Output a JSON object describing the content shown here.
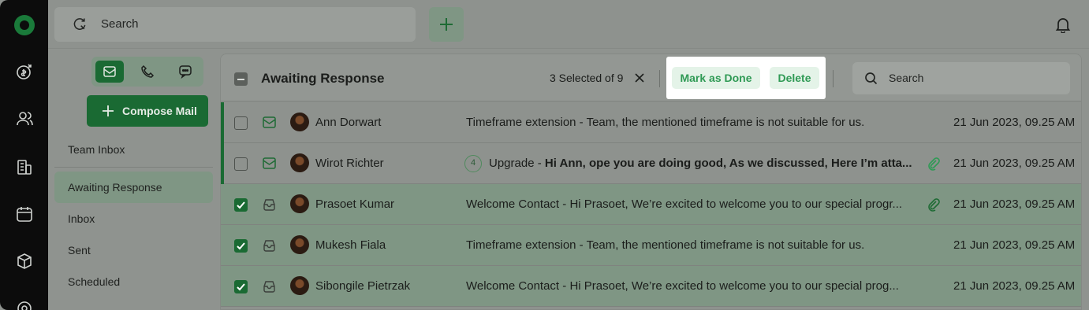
{
  "colors": {
    "brand": "#1a6a33",
    "highlight": "#e4f3e8",
    "highlight_text": "#2f9a55"
  },
  "rail": {
    "icons": [
      "logo-icon",
      "billing-icon",
      "contacts-icon",
      "company-icon",
      "calendar-icon",
      "package-icon",
      "settings-icon"
    ]
  },
  "topbar": {
    "search_placeholder": "Search"
  },
  "sidebar": {
    "compose_label": "Compose Mail",
    "items": [
      {
        "label": "Team Inbox"
      },
      {
        "label": "Awaiting Response",
        "active": true
      },
      {
        "label": "Inbox"
      },
      {
        "label": "Sent"
      },
      {
        "label": "Scheduled"
      }
    ]
  },
  "header": {
    "title": "Awaiting Response",
    "selected_text": "3 Selected of 9",
    "mark_done_label": "Mark as Done",
    "delete_label": "Delete",
    "search_placeholder": "Search"
  },
  "rows": [
    {
      "name": "Ann Dorwart",
      "subject": "Timeframe extension",
      "sep": " - ",
      "preview": "Team, the mentioned timeframe is not suitable for us.",
      "date": "21 Jun 2023, 09.25 AM",
      "checked": false,
      "count": null,
      "attachment": false,
      "preview_bold": false
    },
    {
      "name": "Wirot Richter",
      "subject": "Upgrade",
      "sep": " - ",
      "preview": "Hi Ann, ope you are doing good, As we discussed, Here I’m atta...",
      "date": "21 Jun 2023, 09.25 AM",
      "checked": false,
      "count": "4",
      "attachment": true,
      "preview_bold": true
    },
    {
      "name": "Prasoet Kumar",
      "subject": "Welcome Contact",
      "sep": " - ",
      "preview": "Hi Prasoet, We’re excited to welcome you to our special progr...",
      "date": "21 Jun 2023, 09.25 AM",
      "checked": true,
      "count": null,
      "attachment": true,
      "preview_bold": false
    },
    {
      "name": "Mukesh Fiala",
      "subject": "Timeframe extension",
      "sep": " - ",
      "preview": "Team, the mentioned timeframe is not suitable for us.",
      "date": "21 Jun 2023, 09.25 AM",
      "checked": true,
      "count": null,
      "attachment": false,
      "preview_bold": false
    },
    {
      "name": "Sibongile Pietrzak",
      "subject": "Welcome Contact",
      "sep": " - ",
      "preview": "Hi Prasoet, We’re excited to welcome you to our special prog...",
      "date": "21 Jun 2023, 09.25 AM",
      "checked": true,
      "count": null,
      "attachment": false,
      "preview_bold": false
    }
  ]
}
